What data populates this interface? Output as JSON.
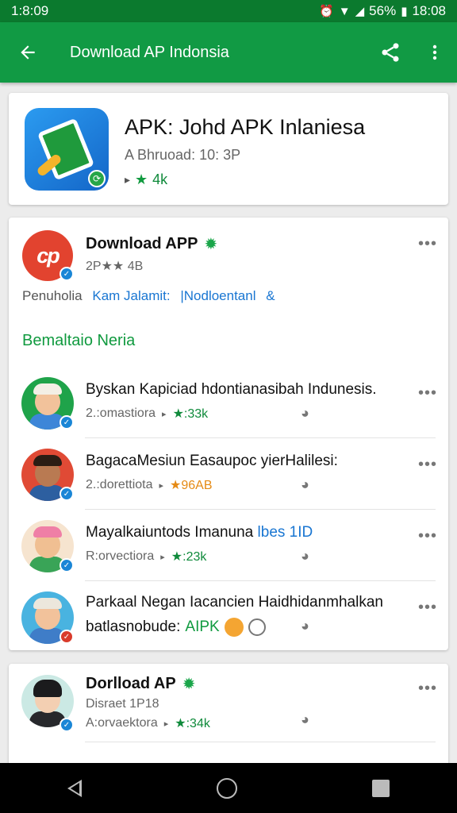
{
  "status_bar": {
    "time_left": "1:8:09",
    "alarm_icon": "alarm-icon",
    "battery": "56%",
    "time_right": "18:08"
  },
  "app_bar": {
    "title": "Download AP Indonsia",
    "back_icon": "arrow-left-icon",
    "share_icon": "share-icon",
    "more_icon": "more-vert-icon"
  },
  "featured_app": {
    "title": "APK: Johd APK Inlaniesa",
    "subtitle": "A Bhruoad: 10: 3P",
    "rating_text": "4k"
  },
  "developer": {
    "logo_text": "cp",
    "name": "Download APP",
    "meta": "2P★★ 4B",
    "link_1": "Penuholia",
    "link_2": "Kam Jalamit:",
    "link_3": "|Nodloentanl",
    "link_3_icon": "&"
  },
  "section": {
    "heading": "Bemaltaio Neria"
  },
  "apps": [
    {
      "title": "Byskan Kapiciad hdontianasibah Indunesis.",
      "developer": "2.:omastiora",
      "rating": "★:33k"
    },
    {
      "title": "BagacaMesiun Easaupoc yierHalilesi:",
      "developer": "2.:dorettiota",
      "rating": "★96AB"
    },
    {
      "title": "Mayalkaiuntods Imanuna",
      "title_link": "lbes 1ID",
      "developer": "R:orvectiora",
      "rating": "★:23k"
    },
    {
      "title_line1": "Parkaal Negan Iacancien Haidhidanmhalkan",
      "title_line2": "batlasnobude:",
      "apk_tag": "AIPK"
    }
  ],
  "second_developer": {
    "name": "Dorlload AP",
    "meta": "Disraet 1P18",
    "developer": "A:orvaektora",
    "rating": "★:34k"
  },
  "colors": {
    "status_bar": "#0b7a2e",
    "app_bar": "#119a44",
    "accent_green": "#109a3f",
    "link_blue": "#1976d2"
  }
}
